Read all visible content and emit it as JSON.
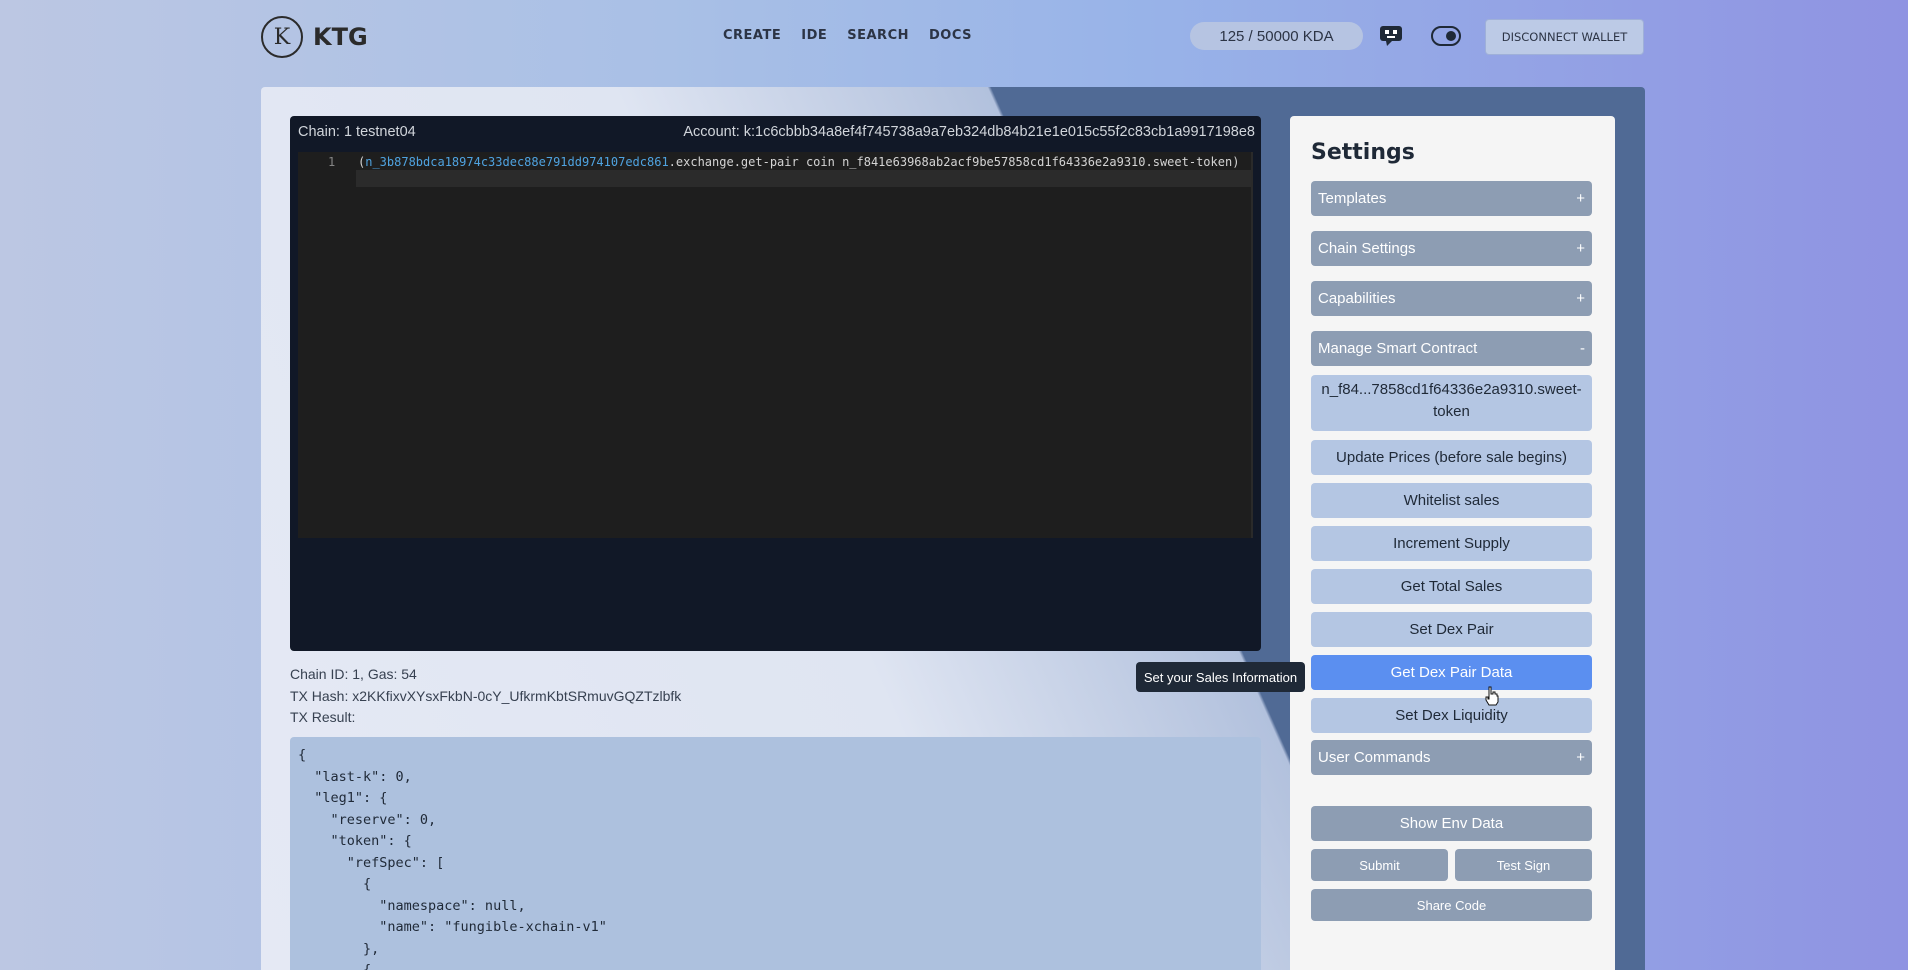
{
  "brand": {
    "logo_letter": "K",
    "name": "KTG"
  },
  "nav": {
    "links": [
      "CREATE",
      "IDE",
      "SEARCH",
      "DOCS"
    ]
  },
  "wallet": {
    "balance": "125 / 50000 KDA",
    "disconnect_label": "DISCONNECT WALLET"
  },
  "icons": {
    "assistant": "robot-chat-icon",
    "theme_toggle": "toggle-icon",
    "cursor": "hand-pointer-icon"
  },
  "editor": {
    "chain_label": "Chain: 1 testnet04",
    "account_label": "Account: k:1c6cbbb34a8ef4f745738a9a7eb324db84b21e1e015c55f2c83cb1a9917198e8",
    "line_number": "1",
    "code_open": "(",
    "code_namespace": "n_3b878bdca18974c33dec88e791dd974107edc861",
    "code_rest": ".exchange.get-pair coin n_f841e63968ab2acf9be57858cd1f64336e2a9310.sweet-token)"
  },
  "tx": {
    "chain_gas": "Chain ID: 1, Gas: 54",
    "hash": "TX Hash: x2KKfixvXYsxFkbN-0cY_UfkrmKbtSRmuvGQZTzlbfk",
    "result_label": "TX Result:",
    "result_json": "{\n  \"last-k\": 0,\n  \"leg1\": {\n    \"reserve\": 0,\n    \"token\": {\n      \"refSpec\": [\n        {\n          \"namespace\": null,\n          \"name\": \"fungible-xchain-v1\"\n        },\n        {"
  },
  "settings": {
    "title": "Settings",
    "sections": [
      {
        "label": "Templates",
        "sign": "+"
      },
      {
        "label": "Chain Settings",
        "sign": "+"
      },
      {
        "label": "Capabilities",
        "sign": "+"
      },
      {
        "label": "Manage Smart Contract",
        "sign": "-"
      }
    ],
    "contract_name": "n_f84...7858cd1f64336e2a9310.sweet-token",
    "contract_actions": [
      "Update Prices (before sale begins)",
      "Whitelist sales",
      "Increment Supply",
      "Get Total Sales",
      "Set Dex Pair",
      "Get Dex Pair Data",
      "Set Dex Liquidity"
    ],
    "active_action": "Get Dex Pair Data",
    "user_commands": {
      "label": "User Commands",
      "sign": "+"
    },
    "show_env_label": "Show Env Data",
    "submit_label": "Submit",
    "test_sign_label": "Test Sign",
    "share_label": "Share Code"
  },
  "tooltip": "Set your Sales Information",
  "colors": {
    "accent": "#5b8ff0",
    "editor_bg": "#111827",
    "accordion": "#8d9db3",
    "button": "#b4c6e3"
  }
}
